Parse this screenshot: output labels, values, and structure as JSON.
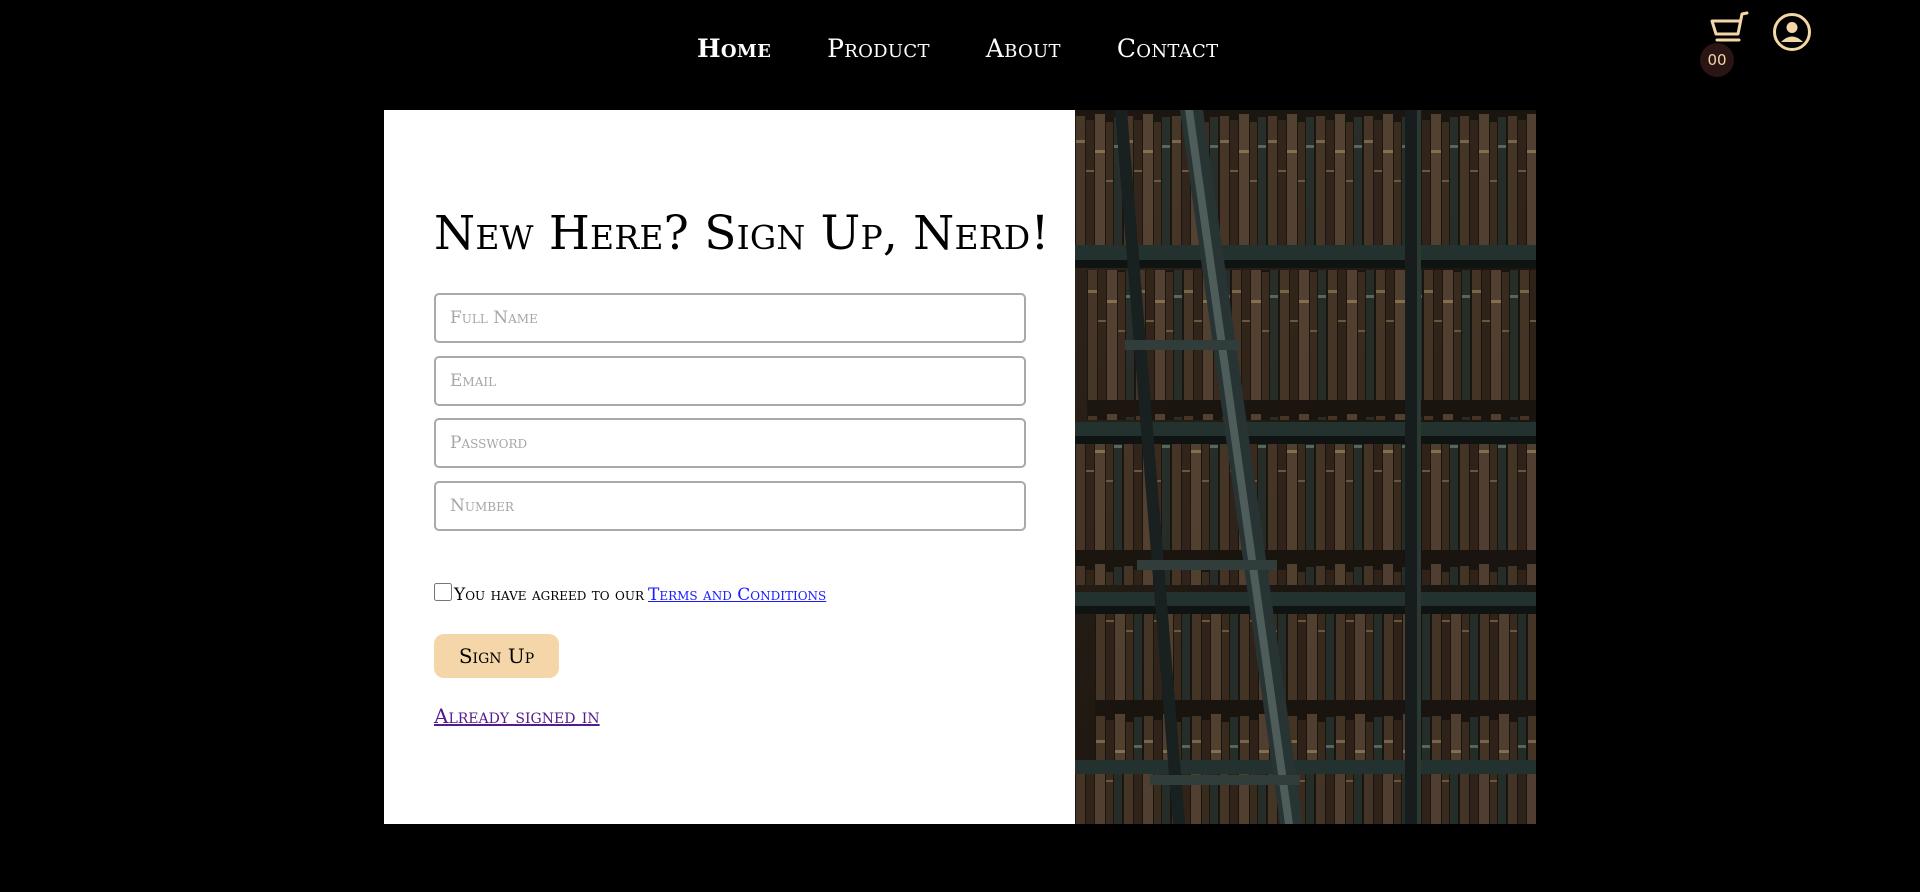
{
  "nav": {
    "links": [
      "Home",
      "Product",
      "About",
      "Contact"
    ],
    "cart_count": "00",
    "accent_color": "#f5d6a8"
  },
  "signup": {
    "title": "New Here? Sign Up, Nerd!",
    "fields": {
      "full_name_placeholder": "Full Name",
      "email_placeholder": "Email",
      "password_placeholder": "Password",
      "number_placeholder": "Number"
    },
    "terms_text": "You have agreed to our",
    "terms_link": "Terms and Conditions",
    "submit_label": "Sign Up",
    "signin_link": "Already signed in"
  },
  "icons": [
    "cart-icon",
    "profile-icon",
    "checkbox"
  ],
  "colors": {
    "background": "#000000",
    "button": "#f5d6a8",
    "link_terms": "#1a1aff",
    "link_visited": "#551a8b"
  }
}
